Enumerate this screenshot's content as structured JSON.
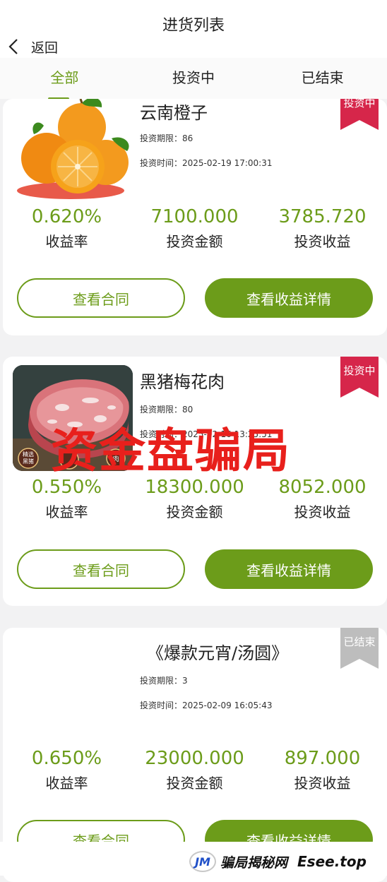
{
  "header": {
    "title": "进货列表",
    "back_label": "返回"
  },
  "tabs": [
    {
      "label": "全部",
      "active": true
    },
    {
      "label": "投资中",
      "active": false
    },
    {
      "label": "已结束",
      "active": false
    }
  ],
  "labels": {
    "period_prefix": "投资期限：",
    "time_prefix": "投资时间：",
    "rate_label": "收益率",
    "amount_label": "投资金额",
    "profit_label": "投资收益",
    "contract_button": "查看合同",
    "detail_button": "查看收益详情"
  },
  "products": [
    {
      "name": "云南橙子",
      "period": "86",
      "time": "2025-02-19 17:00:31",
      "rate": "0.620%",
      "amount": "7100.000",
      "profit": "3785.720",
      "status": "投资中",
      "status_color": "#d6264a",
      "image": "orange-fruit"
    },
    {
      "name": "黑猪梅花肉",
      "period": "80",
      "time": "2025-02-16 13:25:51",
      "rate": "0.550%",
      "amount": "18300.000",
      "profit": "8052.000",
      "status": "投资中",
      "status_color": "#d6264a",
      "image": "pork-meat",
      "image_badges": [
        "精选",
        "黑猪",
        "肉"
      ]
    },
    {
      "name": "《爆款元宵/汤圆》",
      "period": "3",
      "time": "2025-02-09 16:05:43",
      "rate": "0.650%",
      "amount": "23000.000",
      "profit": "897.000",
      "status": "已结束",
      "status_color": "#bdbdbd"
    }
  ],
  "watermark": "资金盘骗局",
  "footer": {
    "logo_mark": "JM",
    "logo_text": "骗局揭秘网",
    "site": "Esee.top"
  },
  "colors": {
    "accent": "#6c9c1a",
    "active_ribbon": "#d6264a",
    "ended_ribbon": "#bdbdbd",
    "watermark": "#e8201c"
  }
}
